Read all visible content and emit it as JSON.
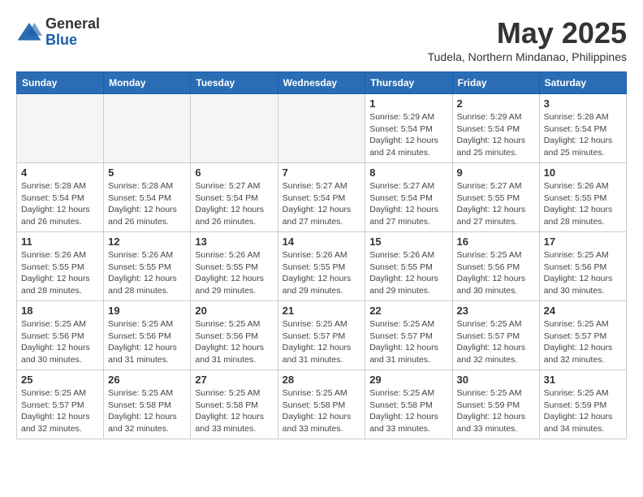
{
  "logo": {
    "general": "General",
    "blue": "Blue"
  },
  "title": "May 2025",
  "subtitle": "Tudela, Northern Mindanao, Philippines",
  "headers": [
    "Sunday",
    "Monday",
    "Tuesday",
    "Wednesday",
    "Thursday",
    "Friday",
    "Saturday"
  ],
  "weeks": [
    [
      {
        "day": "",
        "info": ""
      },
      {
        "day": "",
        "info": ""
      },
      {
        "day": "",
        "info": ""
      },
      {
        "day": "",
        "info": ""
      },
      {
        "day": "1",
        "info": "Sunrise: 5:29 AM\nSunset: 5:54 PM\nDaylight: 12 hours\nand 24 minutes."
      },
      {
        "day": "2",
        "info": "Sunrise: 5:29 AM\nSunset: 5:54 PM\nDaylight: 12 hours\nand 25 minutes."
      },
      {
        "day": "3",
        "info": "Sunrise: 5:28 AM\nSunset: 5:54 PM\nDaylight: 12 hours\nand 25 minutes."
      }
    ],
    [
      {
        "day": "4",
        "info": "Sunrise: 5:28 AM\nSunset: 5:54 PM\nDaylight: 12 hours\nand 26 minutes."
      },
      {
        "day": "5",
        "info": "Sunrise: 5:28 AM\nSunset: 5:54 PM\nDaylight: 12 hours\nand 26 minutes."
      },
      {
        "day": "6",
        "info": "Sunrise: 5:27 AM\nSunset: 5:54 PM\nDaylight: 12 hours\nand 26 minutes."
      },
      {
        "day": "7",
        "info": "Sunrise: 5:27 AM\nSunset: 5:54 PM\nDaylight: 12 hours\nand 27 minutes."
      },
      {
        "day": "8",
        "info": "Sunrise: 5:27 AM\nSunset: 5:54 PM\nDaylight: 12 hours\nand 27 minutes."
      },
      {
        "day": "9",
        "info": "Sunrise: 5:27 AM\nSunset: 5:55 PM\nDaylight: 12 hours\nand 27 minutes."
      },
      {
        "day": "10",
        "info": "Sunrise: 5:26 AM\nSunset: 5:55 PM\nDaylight: 12 hours\nand 28 minutes."
      }
    ],
    [
      {
        "day": "11",
        "info": "Sunrise: 5:26 AM\nSunset: 5:55 PM\nDaylight: 12 hours\nand 28 minutes."
      },
      {
        "day": "12",
        "info": "Sunrise: 5:26 AM\nSunset: 5:55 PM\nDaylight: 12 hours\nand 28 minutes."
      },
      {
        "day": "13",
        "info": "Sunrise: 5:26 AM\nSunset: 5:55 PM\nDaylight: 12 hours\nand 29 minutes."
      },
      {
        "day": "14",
        "info": "Sunrise: 5:26 AM\nSunset: 5:55 PM\nDaylight: 12 hours\nand 29 minutes."
      },
      {
        "day": "15",
        "info": "Sunrise: 5:26 AM\nSunset: 5:55 PM\nDaylight: 12 hours\nand 29 minutes."
      },
      {
        "day": "16",
        "info": "Sunrise: 5:25 AM\nSunset: 5:56 PM\nDaylight: 12 hours\nand 30 minutes."
      },
      {
        "day": "17",
        "info": "Sunrise: 5:25 AM\nSunset: 5:56 PM\nDaylight: 12 hours\nand 30 minutes."
      }
    ],
    [
      {
        "day": "18",
        "info": "Sunrise: 5:25 AM\nSunset: 5:56 PM\nDaylight: 12 hours\nand 30 minutes."
      },
      {
        "day": "19",
        "info": "Sunrise: 5:25 AM\nSunset: 5:56 PM\nDaylight: 12 hours\nand 31 minutes."
      },
      {
        "day": "20",
        "info": "Sunrise: 5:25 AM\nSunset: 5:56 PM\nDaylight: 12 hours\nand 31 minutes."
      },
      {
        "day": "21",
        "info": "Sunrise: 5:25 AM\nSunset: 5:57 PM\nDaylight: 12 hours\nand 31 minutes."
      },
      {
        "day": "22",
        "info": "Sunrise: 5:25 AM\nSunset: 5:57 PM\nDaylight: 12 hours\nand 31 minutes."
      },
      {
        "day": "23",
        "info": "Sunrise: 5:25 AM\nSunset: 5:57 PM\nDaylight: 12 hours\nand 32 minutes."
      },
      {
        "day": "24",
        "info": "Sunrise: 5:25 AM\nSunset: 5:57 PM\nDaylight: 12 hours\nand 32 minutes."
      }
    ],
    [
      {
        "day": "25",
        "info": "Sunrise: 5:25 AM\nSunset: 5:57 PM\nDaylight: 12 hours\nand 32 minutes."
      },
      {
        "day": "26",
        "info": "Sunrise: 5:25 AM\nSunset: 5:58 PM\nDaylight: 12 hours\nand 32 minutes."
      },
      {
        "day": "27",
        "info": "Sunrise: 5:25 AM\nSunset: 5:58 PM\nDaylight: 12 hours\nand 33 minutes."
      },
      {
        "day": "28",
        "info": "Sunrise: 5:25 AM\nSunset: 5:58 PM\nDaylight: 12 hours\nand 33 minutes."
      },
      {
        "day": "29",
        "info": "Sunrise: 5:25 AM\nSunset: 5:58 PM\nDaylight: 12 hours\nand 33 minutes."
      },
      {
        "day": "30",
        "info": "Sunrise: 5:25 AM\nSunset: 5:59 PM\nDaylight: 12 hours\nand 33 minutes."
      },
      {
        "day": "31",
        "info": "Sunrise: 5:25 AM\nSunset: 5:59 PM\nDaylight: 12 hours\nand 34 minutes."
      }
    ]
  ]
}
